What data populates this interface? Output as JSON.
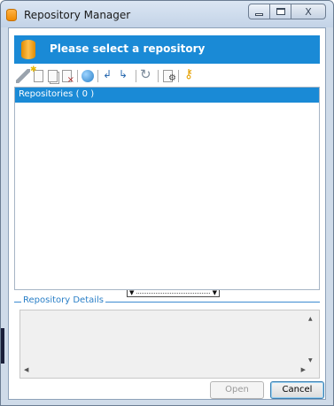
{
  "window": {
    "title": "Repository Manager",
    "icon": "database-icon",
    "controls": {
      "minimize": "minimize-icon",
      "maximize": "maximize-icon",
      "close": "X"
    }
  },
  "banner": {
    "title": "Please select a repository",
    "icon": "database-icon",
    "color": "#1a8ad6"
  },
  "toolbar": {
    "items": [
      {
        "name": "edit-icon"
      },
      {
        "name": "new-repository-icon"
      },
      {
        "name": "copy-repository-icon"
      },
      {
        "name": "delete-repository-icon"
      },
      {
        "name": "connect-icon"
      },
      {
        "name": "import-icon"
      },
      {
        "name": "export-icon"
      },
      {
        "name": "refresh-icon"
      },
      {
        "name": "settings-icon"
      },
      {
        "name": "key-icon"
      }
    ]
  },
  "repositories": {
    "header": "Repositories ( 0 )",
    "items": []
  },
  "details": {
    "label": "Repository Details"
  },
  "buttons": {
    "open": "Open",
    "cancel": "Cancel"
  }
}
